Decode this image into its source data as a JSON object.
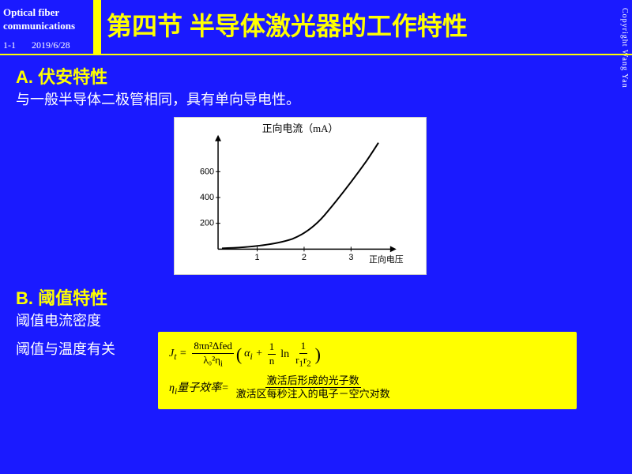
{
  "header": {
    "logo_line1": "Optical fiber",
    "logo_line2": "communications",
    "slide_number": "1-1",
    "date": "2019/6/28",
    "title": "第四节  半导体激光器的工作特性",
    "copyright": "Copyright Wang Yan"
  },
  "section_a": {
    "title": "A. 伏安特性",
    "description": "与一般半导体二极管相同，具有单向导电性。"
  },
  "section_b": {
    "title": "B. 阈值特性",
    "subtitle": "阈值电流密度",
    "note": "阈值与温度有关"
  },
  "chart": {
    "x_label": "正向电压",
    "y_label": "正向电流（mA）",
    "x_ticks": [
      "1",
      "2",
      "3"
    ],
    "y_ticks": [
      "200",
      "400",
      "600"
    ]
  },
  "formula": {
    "lhs": "J_t =",
    "numerator": "8πn²Δfed",
    "denominator": "λ₀²ηᵢ",
    "paren_left": "(",
    "alpha": "αᵢ +",
    "fraction_ln": "1/n",
    "ln_label": "ln",
    "fraction_r": "1/(r₁r₂)",
    "paren_right": ")",
    "eta_label": "ηᵢ量子效率=",
    "eta_num": "激活后形成的光子数",
    "eta_den": "激活区每秒注入的电子－空穴对数"
  }
}
